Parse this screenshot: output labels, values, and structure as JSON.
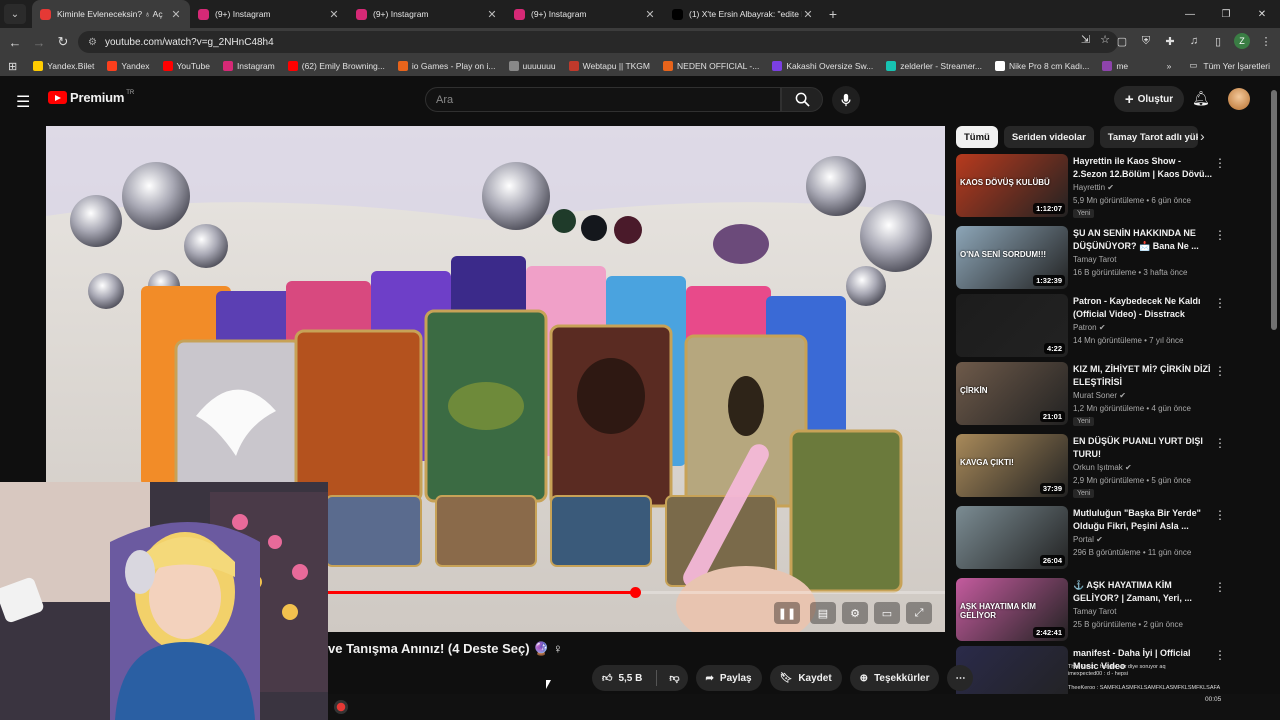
{
  "browser": {
    "tabs": [
      {
        "title": "Kiminle Evleneceksin? ♁ Aç",
        "active": true,
        "color": "#e53935"
      },
      {
        "title": "(9+) Instagram",
        "active": false,
        "color": "#d62976"
      },
      {
        "title": "(9+) Instagram",
        "active": false,
        "color": "#d62976"
      },
      {
        "title": "(9+) Instagram",
        "active": false,
        "color": "#d62976"
      },
      {
        "title": "(1) X'te Ersin Albayrak: \"edite b",
        "active": false,
        "color": "#000000"
      }
    ],
    "url": "youtube.com/watch?v=g_2NHnC48h4",
    "profile_letter": "Z",
    "bookmarks": [
      {
        "label": "Yandex.Bilet",
        "color": "#ffcc00"
      },
      {
        "label": "Yandex",
        "color": "#fc3f1d"
      },
      {
        "label": "YouTube",
        "color": "#ff0000"
      },
      {
        "label": "Instagram",
        "color": "#d62976"
      },
      {
        "label": "(62) Emily Browning...",
        "color": "#ff0000"
      },
      {
        "label": "io Games - Play on i...",
        "color": "#e8641b"
      },
      {
        "label": "uuuuuuu",
        "color": "#888888"
      },
      {
        "label": "Webtapu || TKGM",
        "color": "#c0392b"
      },
      {
        "label": "NEDEN OFFICIAL -...",
        "color": "#e8641b"
      },
      {
        "label": "Kakashi Oversize Sw...",
        "color": "#7b3fe4"
      },
      {
        "label": "zelderler - Streamer...",
        "color": "#17c3b2"
      },
      {
        "label": "Nike Pro 8 cm Kadı...",
        "color": "#ffffff"
      },
      {
        "label": "me",
        "color": "#8e44ad"
      }
    ],
    "all_bookmarks": "Tüm Yer İşaretleri"
  },
  "youtube": {
    "logo_word": "Premium",
    "logo_region": "TR",
    "search_placeholder": "Ara",
    "create_label": "Oluştur",
    "video_title": "ve Tanışma Anınız! (4 Deste Seç) 🔮 ♀",
    "like_count": "5,5 B",
    "share_label": "Paylaş",
    "save_label": "Kaydet",
    "thanks_label": "Teşekkürler",
    "progress_fraction": 0.655,
    "chips": [
      "Tümü",
      "Seriden videolar",
      "Tamay Tarot adlı yükl"
    ],
    "related": [
      {
        "title": "Hayrettin ile Kaos Show - 2.Sezon 12.Bölüm | Kaos Dövü...",
        "channel": "Hayrettin",
        "verified": true,
        "meta": "5,9 Mn görüntüleme • 6 gün önce",
        "duration": "1:12:07",
        "badge": "Yeni",
        "thumb": "#b83a1e",
        "thumb_text": "KAOS DÖVÜŞ KULÜBÜ"
      },
      {
        "title": "ŞU AN SENİN HAKKINDA NE DÜŞÜNÜYOR? 📩 Bana Ne ...",
        "channel": "Tamay Tarot",
        "verified": false,
        "meta": "16 B görüntüleme • 3 hafta önce",
        "duration": "1:32:39",
        "badge": "",
        "thumb": "#8da6b8",
        "thumb_text": "O'NA SENİ SORDUM!!!"
      },
      {
        "title": "Patron - Kaybedecek Ne Kaldı (Official Video) - Disstrack",
        "channel": "Patron",
        "verified": true,
        "meta": "14 Mn görüntüleme • 7 yıl önce",
        "duration": "4:22",
        "badge": "",
        "thumb": "#1c1c1c",
        "thumb_text": ""
      },
      {
        "title": "KIZ MI, ZİHİYET Mİ? ÇİRKİN DİZİ ELEŞTİRİSİ",
        "channel": "Murat Soner",
        "verified": true,
        "meta": "1,2 Mn görüntüleme • 4 gün önce",
        "duration": "21:01",
        "badge": "Yeni",
        "thumb": "#6e5a4a",
        "thumb_text": "ÇİRKİN"
      },
      {
        "title": "EN DÜŞÜK PUANLI YURT DIŞI TURU!",
        "channel": "Orkun Işıtmak",
        "verified": true,
        "meta": "2,9 Mn görüntüleme • 5 gün önce",
        "duration": "37:39",
        "badge": "Yeni",
        "thumb": "#a98a5a",
        "thumb_text": "KAVGA ÇIKTI!"
      },
      {
        "title": "Mutluluğun \"Başka Bir Yerde\" Olduğu Fikri, Peşini Asla ...",
        "channel": "Portal",
        "verified": true,
        "meta": "296 B görüntüleme • 11 gün önce",
        "duration": "26:04",
        "badge": "",
        "thumb": "#7b8c93",
        "thumb_text": ""
      },
      {
        "title": "⚓ AŞK HAYATIMA KİM GELİYOR? | Zamanı, Yeri, ...",
        "channel": "Tamay Tarot",
        "verified": false,
        "meta": "25 B görüntüleme • 2 gün önce",
        "duration": "2:42:41",
        "badge": "",
        "thumb": "#c45b9e",
        "thumb_text": "AŞK HAYATIMA KİM GELİYOR"
      },
      {
        "title": "manifest - Daha İyi | Official Music Video",
        "channel": "",
        "verified": false,
        "meta": "",
        "duration": "",
        "badge": "",
        "thumb": "#2a2a4a",
        "thumb_text": ""
      }
    ]
  },
  "overlay": {
    "chat_lines": [
      "TheeKeroo : hangisi var diye soruyor aq",
      "imexpected00 : d - hepsi",
      "",
      "TheeKeroo : SAMFKLASMFKLSAMFKLASMFKLSMFKLSAFA"
    ],
    "clock": "00:05"
  }
}
